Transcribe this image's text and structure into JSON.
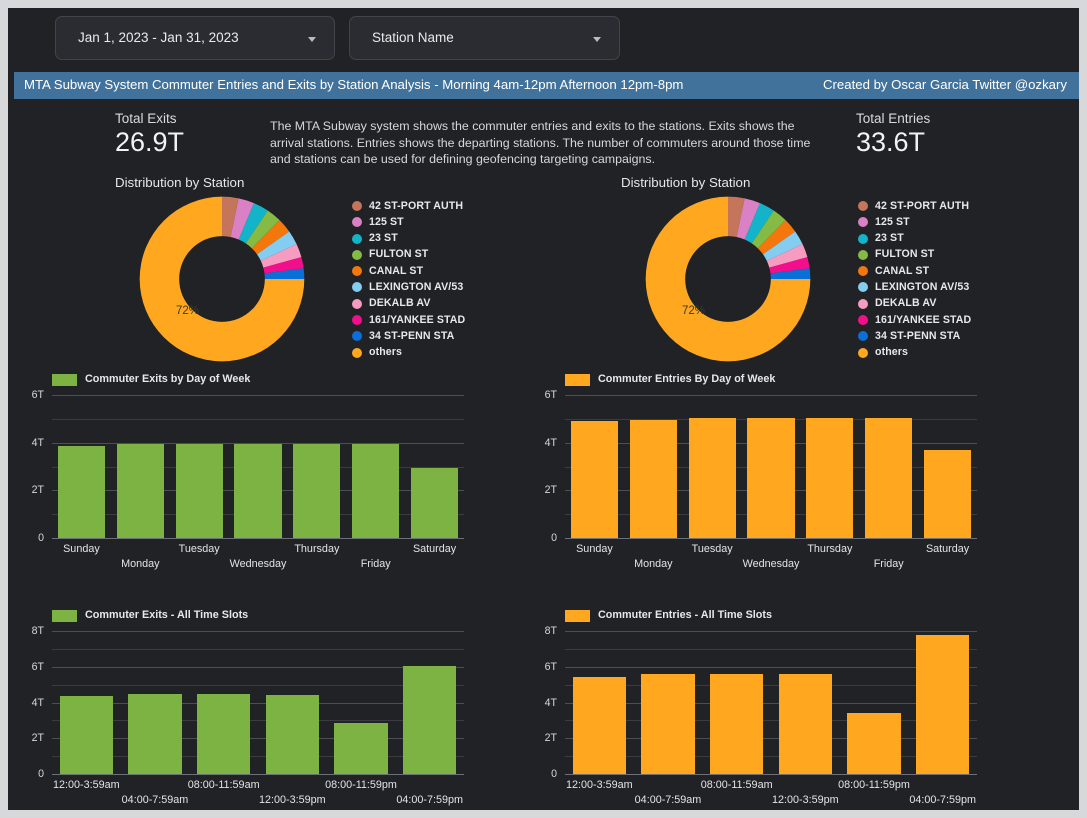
{
  "filters": {
    "date_range": {
      "value": "Jan 1, 2023 - Jan 31, 2023",
      "icon": "chevron-down-icon"
    },
    "station": {
      "value": "Station Name",
      "icon": "chevron-down-icon"
    }
  },
  "banner": {
    "title": "MTA Subway System Commuter Entries and Exits by Station Analysis -  Morning 4am-12pm Afternoon 12pm-8pm",
    "credit": "Created by Oscar Garcia Twitter @ozkary",
    "color": "#41729b"
  },
  "kpi": {
    "exits": {
      "label": "Total Exits",
      "value": "26.9T"
    },
    "entries": {
      "label": "Total Entries",
      "value": "33.6T"
    }
  },
  "description": "The MTA Subway system shows the commuter entries and exits to the stations. Exits shows the arrival stations. Entries shows the departing stations. The number of commuters around those time and stations can be used for defining geofencing targeting campaigns.",
  "colors": {
    "exits_series": "#7cb342",
    "entries_series": "#ffa81f",
    "background": "#212226",
    "grid": "#3a3c41"
  },
  "sections": {
    "left_distribution_title": "Distribution by Station",
    "right_distribution_title": "Distribution by Station"
  },
  "chart_data": [
    {
      "type": "pie",
      "name": "exits-distribution-by-station",
      "title": "Distribution by Station",
      "center_label": "72%",
      "legend_position": "right",
      "labels": [
        "42 ST-PORT AUTH",
        "125 ST",
        "23 ST",
        "FULTON ST",
        "CANAL ST",
        "LEXINGTON AV/53",
        "DEKALB AV",
        "161/YANKEE STAD",
        "34 ST-PENN STA",
        "others"
      ],
      "values": [
        3.1,
        3.0,
        2.9,
        2.8,
        2.8,
        2.7,
        2.6,
        2.1,
        2.0,
        72.0
      ],
      "colors": [
        "#c4755a",
        "#d981c4",
        "#13b4c9",
        "#85bb45",
        "#f4770c",
        "#85cdf0",
        "#f59cc0",
        "#f30f8c",
        "#0b6fd8",
        "#ffa81f"
      ]
    },
    {
      "type": "pie",
      "name": "entries-distribution-by-station",
      "title": "Distribution by Station",
      "center_label": "72%",
      "legend_position": "right",
      "labels": [
        "42 ST-PORT AUTH",
        "125 ST",
        "23 ST",
        "FULTON ST",
        "CANAL ST",
        "LEXINGTON AV/53",
        "DEKALB AV",
        "161/YANKEE STAD",
        "34 ST-PENN STA",
        "others"
      ],
      "values": [
        3.1,
        3.0,
        2.9,
        2.8,
        2.8,
        2.7,
        2.6,
        2.1,
        2.0,
        72.0
      ],
      "colors": [
        "#c4755a",
        "#d981c4",
        "#13b4c9",
        "#85bb45",
        "#f4770c",
        "#85cdf0",
        "#f59cc0",
        "#f30f8c",
        "#0b6fd8",
        "#ffa81f"
      ]
    },
    {
      "type": "bar",
      "name": "exits-by-day-of-week",
      "title": "Commuter Exits by Day of Week",
      "categories": [
        "Sunday",
        "Monday",
        "Tuesday",
        "Wednesday",
        "Thursday",
        "Friday",
        "Saturday"
      ],
      "values": [
        3.88,
        3.93,
        3.96,
        3.96,
        3.96,
        3.96,
        2.95
      ],
      "ylim": [
        0,
        6
      ],
      "yticks": [
        "0",
        "2T",
        "4T",
        "6T"
      ],
      "ylabel": "",
      "xlabel": "",
      "color": "#7cb342",
      "grid": true
    },
    {
      "type": "bar",
      "name": "entries-by-day-of-week",
      "title": "Commuter Entries By Day of Week",
      "categories": [
        "Sunday",
        "Monday",
        "Tuesday",
        "Wednesday",
        "Thursday",
        "Friday",
        "Saturday"
      ],
      "values": [
        4.9,
        4.97,
        5.02,
        5.02,
        5.02,
        5.02,
        3.7
      ],
      "ylim": [
        0,
        6
      ],
      "yticks": [
        "0",
        "2T",
        "4T",
        "6T"
      ],
      "ylabel": "",
      "xlabel": "",
      "color": "#ffa81f",
      "grid": true
    },
    {
      "type": "bar",
      "name": "exits-all-time-slots",
      "title": "Commuter Exits - All Time Slots",
      "categories": [
        "12:00-3:59am",
        "04:00-7:59am",
        "08:00-11:59am",
        "12:00-3:59pm",
        "08:00-11:59pm",
        "04:00-7:59pm"
      ],
      "values": [
        4.35,
        4.48,
        4.48,
        4.43,
        2.85,
        6.02
      ],
      "ylim": [
        0,
        8
      ],
      "yticks": [
        "0",
        "2T",
        "4T",
        "6T",
        "8T"
      ],
      "ylabel": "",
      "xlabel": "",
      "color": "#7cb342",
      "grid": true
    },
    {
      "type": "bar",
      "name": "entries-all-time-slots",
      "title": "Commuter Entries - All Time Slots",
      "categories": [
        "12:00-3:59am",
        "04:00-7:59am",
        "08:00-11:59am",
        "12:00-3:59pm",
        "08:00-11:59pm",
        "04:00-7:59pm"
      ],
      "values": [
        5.45,
        5.6,
        5.6,
        5.6,
        3.4,
        7.75
      ],
      "ylim": [
        0,
        8
      ],
      "yticks": [
        "0",
        "2T",
        "4T",
        "6T",
        "8T"
      ],
      "ylabel": "",
      "xlabel": "",
      "color": "#ffa81f",
      "grid": true
    }
  ]
}
